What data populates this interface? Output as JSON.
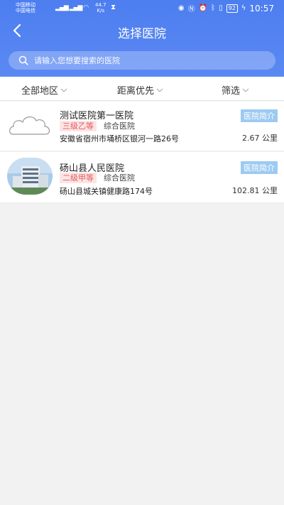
{
  "status_bar": {
    "carrier1": "中国移动",
    "carrier2": "中国电信",
    "speed_value": "44.7",
    "speed_unit": "K/s",
    "battery": "92",
    "time": "10:57"
  },
  "header": {
    "title": "选择医院"
  },
  "search": {
    "placeholder": "请输入您想要搜索的医院"
  },
  "filters": {
    "region": "全部地区",
    "distance": "距离优先",
    "filter": "筛选"
  },
  "hospitals": [
    {
      "name": "测试医院第一医院",
      "level": "三级乙等",
      "type": "综合医院",
      "address": "安徽省宿州市埇桥区银河一路26号",
      "intro_label": "医院简介",
      "distance": "2.67 公里"
    },
    {
      "name": "砀山县人民医院",
      "level": "二级甲等",
      "type": "综合医院",
      "address": "砀山县城关镇健康路174号",
      "intro_label": "医院简介",
      "distance": "102.81 公里"
    }
  ],
  "colors": {
    "header_bg": "#4d7ef0",
    "level_tag_text": "#e25b5b",
    "level_tag_bg": "#fde4e4",
    "intro_bg": "#9dcaf2"
  }
}
